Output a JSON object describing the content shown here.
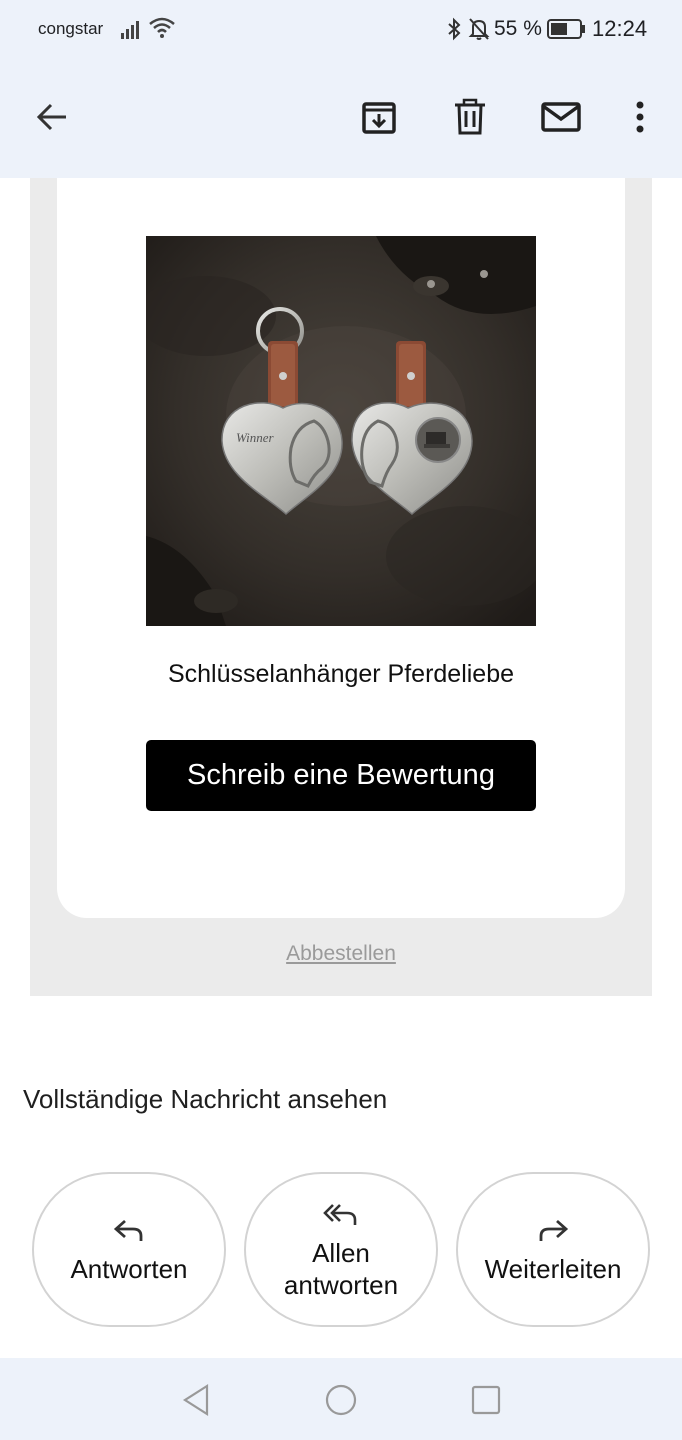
{
  "status_bar": {
    "carrier": "congstar",
    "battery": "55 %",
    "time": "12:24",
    "icons": [
      "signal-icon",
      "wifi-icon",
      "bluetooth-icon",
      "notifications-off-icon",
      "battery-icon"
    ]
  },
  "toolbar": {
    "icons": [
      "back-arrow-icon",
      "archive-icon",
      "delete-icon",
      "mark-unread-icon",
      "more-vert-icon"
    ]
  },
  "email": {
    "product_title": "Schlüsselanhänger Pferdeliebe",
    "review_button": "Schreib eine Bewertung",
    "unsubscribe": "Abbestellen",
    "product_image_text": "Winner"
  },
  "full_message": "Vollständige Nachricht ansehen",
  "actions": {
    "reply": "Antworten",
    "reply_all_line1": "Allen",
    "reply_all_line2": "antworten",
    "forward": "Weiterleiten"
  },
  "nav": {
    "icons": [
      "nav-back-icon",
      "nav-home-icon",
      "nav-recents-icon"
    ]
  },
  "colors": {
    "header_bg": "#edf2fa",
    "email_bg": "#ebebeb",
    "button_bg": "#000000",
    "link_color": "#9a9a9a"
  }
}
